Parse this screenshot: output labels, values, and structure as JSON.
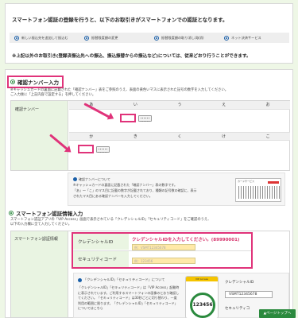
{
  "top": {
    "intro": "スマートフォン認証の登録を行うと、以下のお取引きがスマートフォンでの認証となります。",
    "services": [
      {
        "label": "新しい振込先を追加して振込む",
        "icon": "radio-dot-icon"
      },
      {
        "label": "振替限度額の変更",
        "icon": "radio-dot-icon"
      },
      {
        "label": "振替限度額の取り消し(取消)",
        "icon": "radio-dot-icon"
      },
      {
        "label": "ネット決済サービス",
        "icon": "radio-dot-icon"
      }
    ],
    "note": "※上記以外のお取引き(登録済振込先への振込、振込振替からの振込など)については、従来どおり行うことができます。"
  },
  "confirm": {
    "heading": "確認ナンバー入力",
    "desc1": "※キャッシュカードの裏面に記載された「確認ナンバー」表をご参照のうえ、表面の黄色いマスに表示された記号の数字を入力してください。",
    "desc2": "ご入力後に「上記内容で設定する」を押してください。",
    "row_label": "確認ナンバー",
    "row1": [
      "あ",
      "い",
      "う",
      "え",
      "お"
    ],
    "row2": [
      "か",
      "き",
      "く",
      "け",
      "こ"
    ],
    "help": "確認ナンバーについて",
    "ex1": "※キャッシュカードの裏面に記載された「確認ナンバー」表の数字です。",
    "ex2": "「あ」〜「こ」のマス目に記載の数字が記載されており、種類の記号数の確認に、表示",
    "ex3": "されたマス目にある確認ナンバーを入力してください。",
    "card_title": "カードサービス"
  },
  "sp": {
    "heading": "スマートフォン認証情報入力",
    "desc1": "スマートフォン認証アプリの「VIP Access」画面で表示されている「クレデンシャルID」「セキュリティコード」をご確認のうえ、",
    "desc2": "以下の入力欄に全て入力してください。",
    "row_label": "スマートフォン認証情報",
    "cred_label": "クレデンシャルID",
    "cred_hint": "クレデンシャルIDを入力してください。(89990001)",
    "cred_placeholder": "例：VSMT12345678",
    "sec_label": "セキュリティコード",
    "sec_placeholder": "例：123456",
    "help": "「クレデンシャルID」「セキュリティコード」について",
    "body": "「クレデンシャルID」「セキュリティコード」は「VIP Access」起動時に表示されています。ご利用するスマートフォンの画像のとおり確認してください。「セキュリティコード」は30秒ごとに切り替わり、一度利用の範囲に限ります。「クレデンシャルID」「セキュリティコード」についてはこちら",
    "phone_app": "VIP Access",
    "phone_code": "123456",
    "side_label": "クレデンシャルID",
    "side_value": "VSMT12345678",
    "side_label2": "セキュリティコ"
  },
  "pager": "▲ページトップへ"
}
